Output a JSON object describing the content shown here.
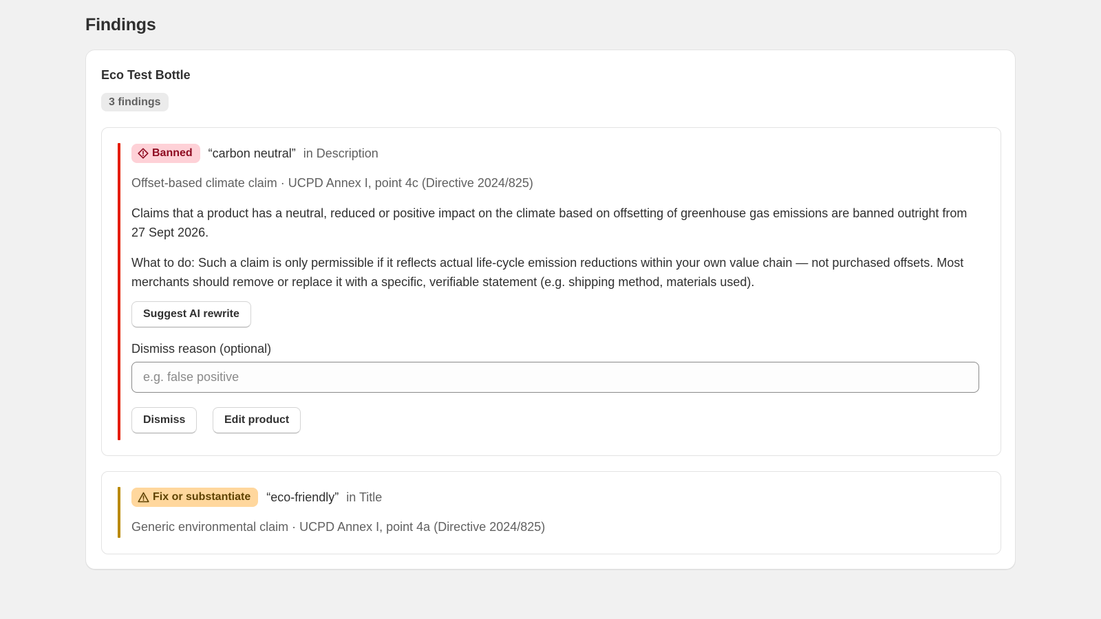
{
  "page": {
    "title": "Findings"
  },
  "product": {
    "title": "Eco Test Bottle",
    "count_label": "3 findings"
  },
  "findings": [
    {
      "severity_label": "Banned",
      "severity_icon": "diamond-alert-icon",
      "accent_color": "#e51c00",
      "claim": "“carbon neutral”",
      "location": "in Description",
      "rule": "Offset-based climate claim · UCPD Annex I, point 4c (Directive 2024/825)",
      "explanation": "Claims that a product has a neutral, reduced or positive impact on the climate based on offsetting of greenhouse gas emissions are banned outright from 27 Sept 2026.",
      "guidance": "What to do: Such a claim is only permissible if it reflects actual life-cycle emission reductions within your own value chain — not purchased offsets. Most merchants should remove or replace it with a specific, verifiable statement (e.g. shipping method, materials used).",
      "suggest_label": "Suggest AI rewrite",
      "dismiss_reason_label": "Dismiss reason (optional)",
      "dismiss_reason_placeholder": "e.g. false positive",
      "dismiss_label": "Dismiss",
      "edit_label": "Edit product"
    },
    {
      "severity_label": "Fix or substantiate",
      "severity_icon": "warning-triangle-icon",
      "accent_color": "#b98900",
      "claim": "“eco-friendly”",
      "location": "in Title",
      "rule": "Generic environmental claim · UCPD Annex I, point 4a (Directive 2024/825)"
    }
  ]
}
